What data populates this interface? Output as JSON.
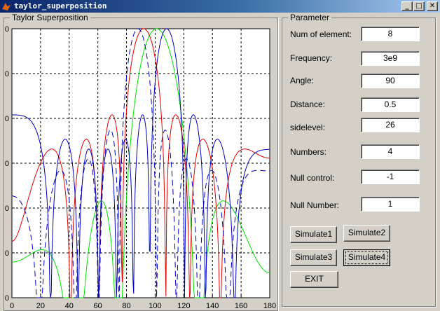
{
  "window": {
    "title": "taylor_superposition",
    "minimize_glyph": "_",
    "maximize_glyph": "□",
    "close_glyph": "✕",
    "icon": "matlab-icon"
  },
  "plot": {
    "panel_title": "Taylor Superposition",
    "xticks": [
      "0",
      "20",
      "40",
      "60",
      "80",
      "100",
      "120",
      "140",
      "160",
      "180"
    ],
    "yticks": [
      "0",
      "0",
      "0",
      "0",
      "0",
      "0",
      "0"
    ]
  },
  "chart_data": {
    "type": "line",
    "title": "",
    "xlabel": "",
    "ylabel": "",
    "xlim": [
      0,
      180
    ],
    "grid": true,
    "colors": {
      "green": "#00e000",
      "red": "#e00000",
      "blue": "#0000c0"
    },
    "series": [
      {
        "color": "green",
        "style": "solid"
      },
      {
        "color": "red",
        "style": "solid"
      },
      {
        "color": "blue",
        "style": "dashed"
      },
      {
        "color": "blue",
        "style": "solid"
      }
    ]
  },
  "params": {
    "title": "Parameter",
    "items": [
      {
        "label": "Num of element:",
        "value": "8"
      },
      {
        "label": "Frequency:",
        "value": "3e9"
      },
      {
        "label": "Angle:",
        "value": "90"
      },
      {
        "label": "Distance:",
        "value": "0.5"
      },
      {
        "label": "sidelevel:",
        "value": "26"
      },
      {
        "label": "Numbers:",
        "value": "4"
      },
      {
        "label": "Null control:",
        "value": "-1"
      },
      {
        "label": "Null Number:",
        "value": "1"
      }
    ]
  },
  "buttons": {
    "simulate1": "Simulate1",
    "simulate2": "Simulate2",
    "simulate3": "Simulate3",
    "simulate4": "Simulate4",
    "exit": "EXIT"
  }
}
